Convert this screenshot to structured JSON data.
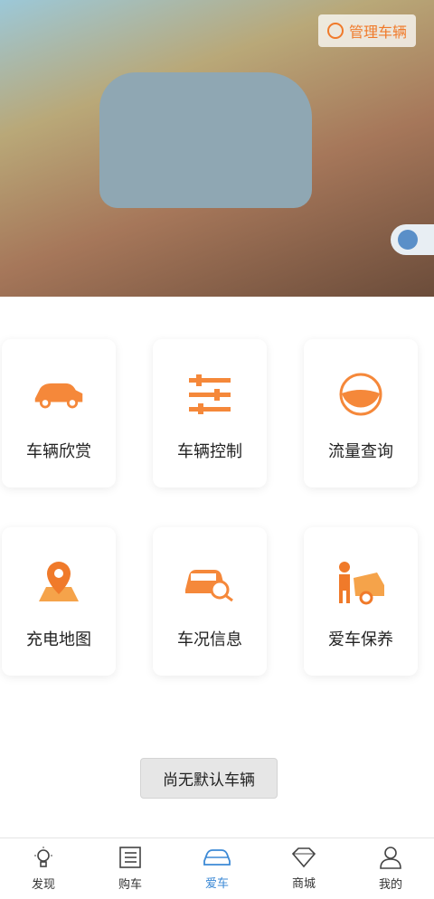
{
  "hero": {
    "manage_label": "管理车辆"
  },
  "features": [
    {
      "label": "车辆欣赏",
      "icon": "car-icon"
    },
    {
      "label": "车辆控制",
      "icon": "sliders-icon"
    },
    {
      "label": "流量查询",
      "icon": "gauge-icon"
    },
    {
      "label": "充电地图",
      "icon": "map-pin-icon"
    },
    {
      "label": "车况信息",
      "icon": "car-search-icon"
    },
    {
      "label": "爱车保养",
      "icon": "mechanic-icon"
    }
  ],
  "no_default_label": "尚无默认车辆",
  "tabs": [
    {
      "label": "发现",
      "icon": "bulb-icon"
    },
    {
      "label": "购车",
      "icon": "list-icon"
    },
    {
      "label": "爱车",
      "icon": "car-icon",
      "active": true
    },
    {
      "label": "商城",
      "icon": "diamond-icon"
    },
    {
      "label": "我的",
      "icon": "user-icon"
    }
  ],
  "colors": {
    "accent": "#f07a2a",
    "active_tab": "#3d8ad6"
  }
}
